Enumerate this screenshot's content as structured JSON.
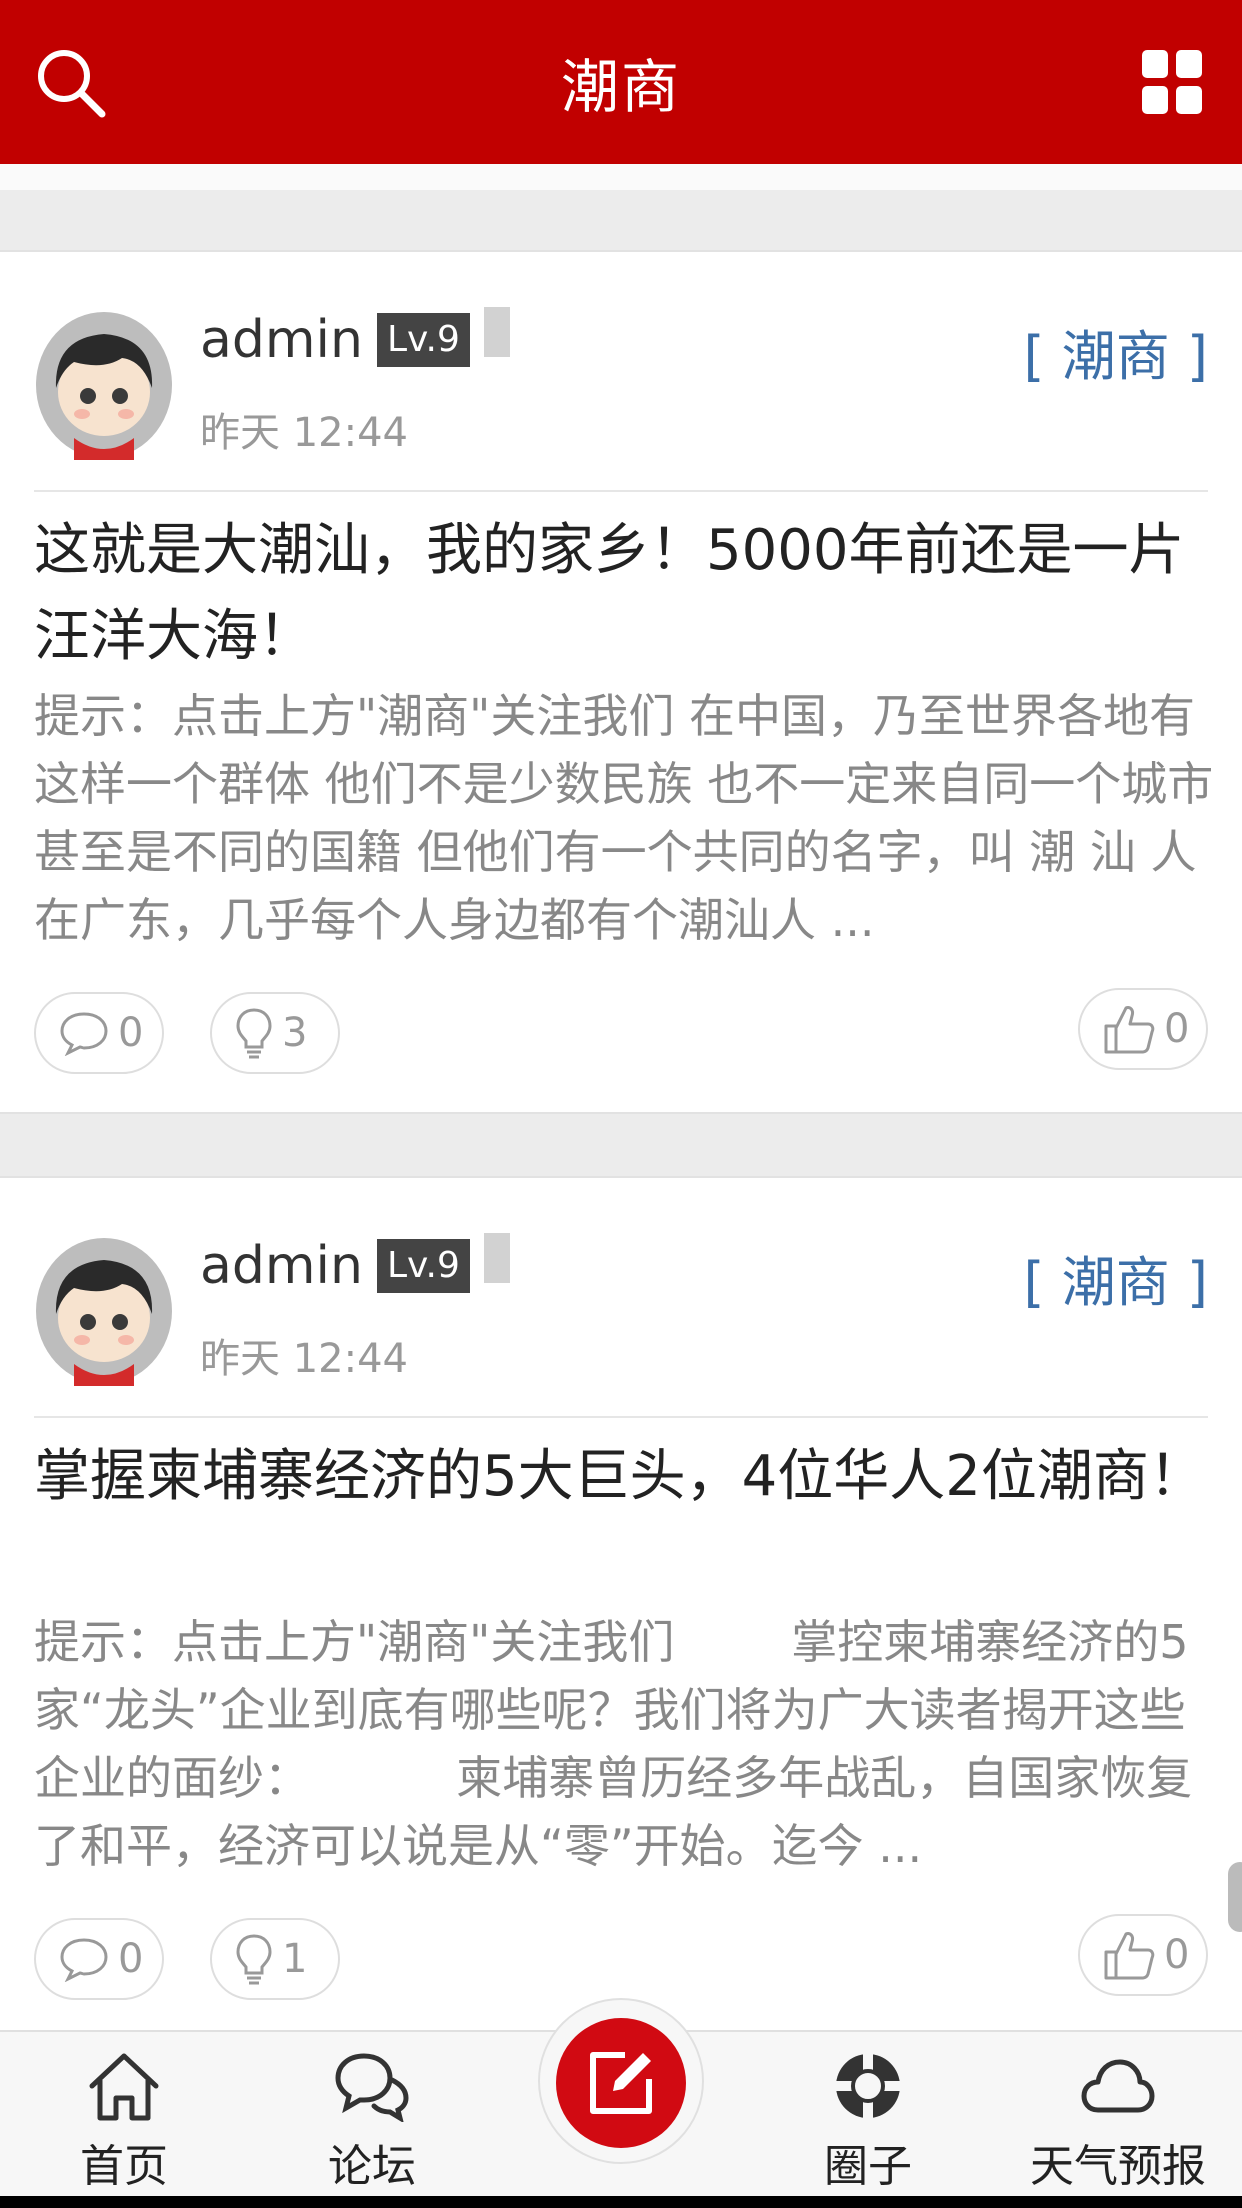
{
  "header": {
    "title": "潮商"
  },
  "posts": [
    {
      "author": "admin",
      "level": "Lv.9",
      "time": "昨天 12:44",
      "tag": "[ 潮商 ]",
      "title": "这就是大潮汕，我的家乡！5000年前还是一片汪洋大海！",
      "excerpt": "提示：点击上方\"潮商\"关注我们 在中国，乃至世界各地有这样一个群体 他们不是少数民族 也不一定来自同一个城市 甚至是不同的国籍 但他们有一个共同的名字，叫 潮 汕 人 在广东，几乎每个人身边都有个潮汕人 ...",
      "comments": "0",
      "views": "3",
      "likes": "0"
    },
    {
      "author": "admin",
      "level": "Lv.9",
      "time": "昨天 12:44",
      "tag": "[ 潮商 ]",
      "title": "掌握柬埔寨经济的5大巨头，4位华人2位潮商！",
      "excerpt": "提示：点击上方\"潮商\"关注我们        掌控柬埔寨经济的5家“龙头”企业到底有哪些呢？我们将为广大读者揭开这些企业的面纱：          柬埔寨曾历经多年战乱，自国家恢复了和平，经济可以说是从“零”开始。迄今 ...",
      "comments": "0",
      "views": "1",
      "likes": "0"
    }
  ],
  "nav": {
    "home": "首页",
    "forum": "论坛",
    "circle": "圈子",
    "weather": "天气预报"
  },
  "colors": {
    "brand": "#c10000",
    "tag": "#3c6fa8"
  }
}
